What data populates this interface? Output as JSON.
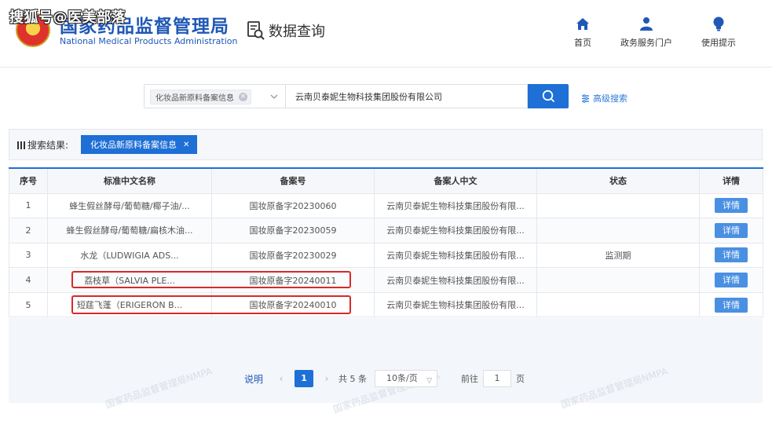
{
  "watermark": "搜狐号@医美部落",
  "header": {
    "org_cn": "国家药品监督管理局",
    "org_en": "National Medical Products Administration",
    "page_title": "数据查询",
    "nav": [
      {
        "label": "首页",
        "icon": "home-icon"
      },
      {
        "label": "政务服务门户",
        "icon": "user-icon"
      },
      {
        "label": "使用提示",
        "icon": "lightbulb-icon"
      }
    ],
    "brand_color": "#1f58b6"
  },
  "search": {
    "category_tag": "化妆品新原料备案信息",
    "keyword": "云南贝泰妮生物科技集团股份有限公司",
    "advanced_label": "高级搜索",
    "button_color": "#1e6fd6"
  },
  "results": {
    "label": "搜索结果:",
    "tab": "化妆品新原料备案信息"
  },
  "table": {
    "headers": [
      "序号",
      "标准中文名称",
      "备案号",
      "备案人中文",
      "状态",
      "详情"
    ],
    "rows": [
      {
        "no": "1",
        "name": "蜂生假丝酵母/葡萄糖/椰子油/...",
        "record": "国妆原备字20230060",
        "applicant": "云南贝泰妮生物科技集团股份有限...",
        "status": "",
        "detail": "详情"
      },
      {
        "no": "2",
        "name": "蜂生假丝酵母/葡萄糖/扁核木油...",
        "record": "国妆原备字20230059",
        "applicant": "云南贝泰妮生物科技集团股份有限...",
        "status": "",
        "detail": "详情"
      },
      {
        "no": "3",
        "name": "水龙（LUDWIGIA ADS...",
        "record": "国妆原备字20230029",
        "applicant": "云南贝泰妮生物科技集团股份有限...",
        "status": "监测期",
        "detail": "详情"
      },
      {
        "no": "4",
        "name": "荔枝草（SALVIA PLE...",
        "record": "国妆原备字20240011",
        "applicant": "云南贝泰妮生物科技集团股份有限...",
        "status": "",
        "detail": "详情"
      },
      {
        "no": "5",
        "name": "短莛飞蓬（ERIGERON B...",
        "record": "国妆原备字20240010",
        "applicant": "云南贝泰妮生物科技集团股份有限...",
        "status": "",
        "detail": "详情"
      }
    ]
  },
  "pagination": {
    "note": "说明",
    "prev": "‹",
    "current": "1",
    "next": "›",
    "total": "共 5 条",
    "page_size": "10条/页",
    "goto_label": "前往",
    "goto_value": "1",
    "page_unit": "页"
  },
  "bg_watermark": "国家药品监督管理局NMPA"
}
